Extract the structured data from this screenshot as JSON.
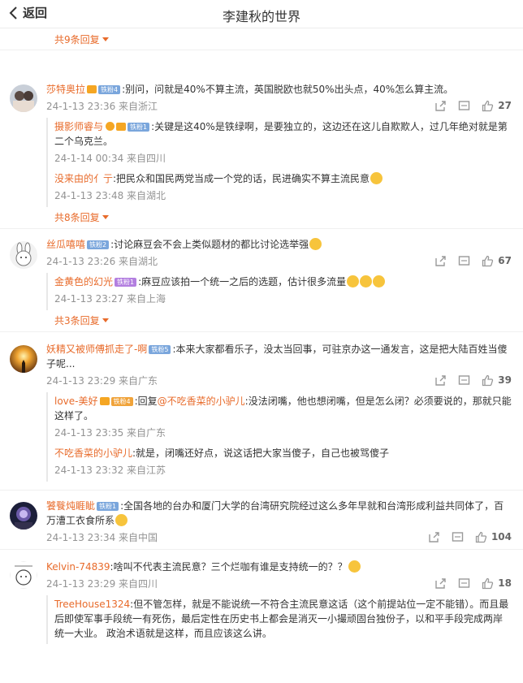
{
  "header": {
    "back_label": "返回",
    "title": "李建秋的世界"
  },
  "top_more": "共9条回复",
  "comments": [
    {
      "user": "莎特奥拉",
      "fan_badge": "铁粉4",
      "text": ":别问，问就是40%不算主流，英国脱欧也就50%出头点，40%怎么算主流。",
      "time": "24-1-13 23:36 来自浙江",
      "likes": "27",
      "replies": [
        {
          "user": "摄影师睿与",
          "fan_badge": "铁粉1",
          "text": ":关键是这40%是铁绿啊，是要独立的，这边还在这儿自欺欺人，过几年绝对就是第二个乌克兰。",
          "time": "24-1-14 00:34 来自四川"
        },
        {
          "user": "没来由的亻亍",
          "text": ":把民众和国民两党当成一个党的话，民进确实不算主流民意",
          "time": "24-1-13 23:48 来自湖北"
        }
      ],
      "more": "共8条回复"
    },
    {
      "user": "丝瓜嘻嘻",
      "fan_badge": "铁粉2",
      "text": ":讨论麻豆会不会上类似题材的都比讨论选举强",
      "time": "24-1-13 23:26 来自湖北",
      "likes": "67",
      "replies": [
        {
          "user": "金黄色的幻光",
          "fan_badge": "铁粉1",
          "text": ":麻豆应该拍一个统一之后的选题，估计很多流量",
          "time": "24-1-13 23:27 来自上海"
        }
      ],
      "more": "共3条回复"
    },
    {
      "user": "妖精又被师傅抓走了-啊",
      "fan_badge": "铁粉5",
      "text": ":本来大家都看乐子，没太当回事，可驻京办这一通发言，这是把大陆百姓当傻子呢...",
      "time": "24-1-13 23:29 来自广东",
      "likes": "39",
      "replies": [
        {
          "user": "love-美好",
          "fan_badge": "铁粉4",
          "reply_prefix": ":回复",
          "reply_to": "@不吃香菜的小驴儿",
          "text": ":没法闭嘴，他也想闭嘴，但是怎么闭？必须要说的，那就只能这样了。",
          "time": "24-1-13 23:35 来自广东"
        },
        {
          "user": "不吃香菜的小驴儿",
          "text": ":就是，闭嘴还好点，说这话把大家当傻子，自己也被骂傻子",
          "time": "24-1-13 23:32 来自江苏"
        }
      ]
    },
    {
      "user": "饕餮炖睚眦",
      "fan_badge": "铁粉1",
      "text": ":全国各地的台办和厦门大学的台湾研究院经过这么多年早就和台湾形成利益共同体了，百万漕工衣食所系",
      "time": "24-1-13 23:34 来自中国",
      "likes": "104"
    },
    {
      "user": "Kelvin-74839",
      "text": ":啥叫不代表主流民意？三个烂咖有谁是支持统一的？？",
      "time": "24-1-13 23:29 来自四川",
      "likes": "18",
      "replies": [
        {
          "user": "TreeHouse1324",
          "text": ":但不管怎样，就是不能说统一不符合主流民意这话（这个前提站位一定不能错）。而且最后即使军事手段统一有死伤，最后定性在历史书上都会是消灭一小撮顽固台独份子，以和平手段完成两岸统一大业。 政治术语就是这样，而且应该这么讲。"
        }
      ]
    }
  ]
}
